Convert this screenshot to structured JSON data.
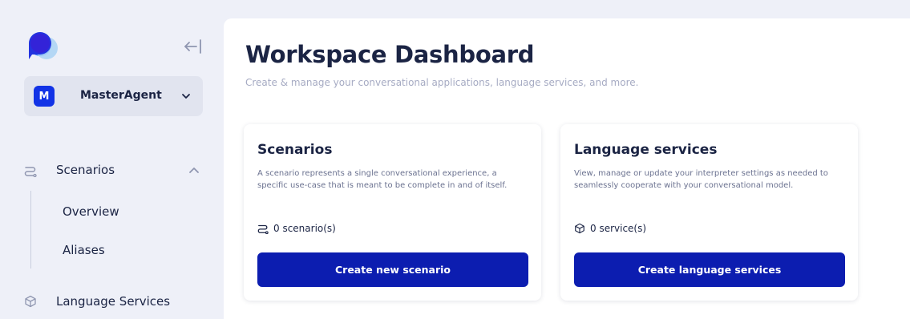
{
  "sidebar": {
    "agent": {
      "initial": "M",
      "name": "MasterAgent"
    },
    "nav": {
      "scenarios": "Scenarios",
      "overview": "Overview",
      "aliases": "Aliases",
      "language_services": "Language Services"
    }
  },
  "main": {
    "title": "Workspace Dashboard",
    "subtitle": "Create & manage your conversational applications, language services, and more.",
    "cards": [
      {
        "title": "Scenarios",
        "description": "A scenario represents a single conversational experience, a specific use-case that is meant to be complete in and of itself.",
        "count": "0 scenario(s)",
        "button": "Create new scenario"
      },
      {
        "title": "Language services",
        "description": "View, manage or update your interpreter settings as needed to seamlessly cooperate with your conversational model.",
        "count": "0 service(s)",
        "button": "Create language services"
      }
    ]
  },
  "colors": {
    "brand": "#1233e6",
    "button": "#0c1db0",
    "background": "#eef0f8",
    "text": "#1b2444",
    "muted": "#a6abc3"
  },
  "icons": [
    "logo-icon",
    "collapse-sidebar-icon",
    "chevron-down-icon",
    "scenarios-icon",
    "chevron-up-icon",
    "cube-icon"
  ]
}
